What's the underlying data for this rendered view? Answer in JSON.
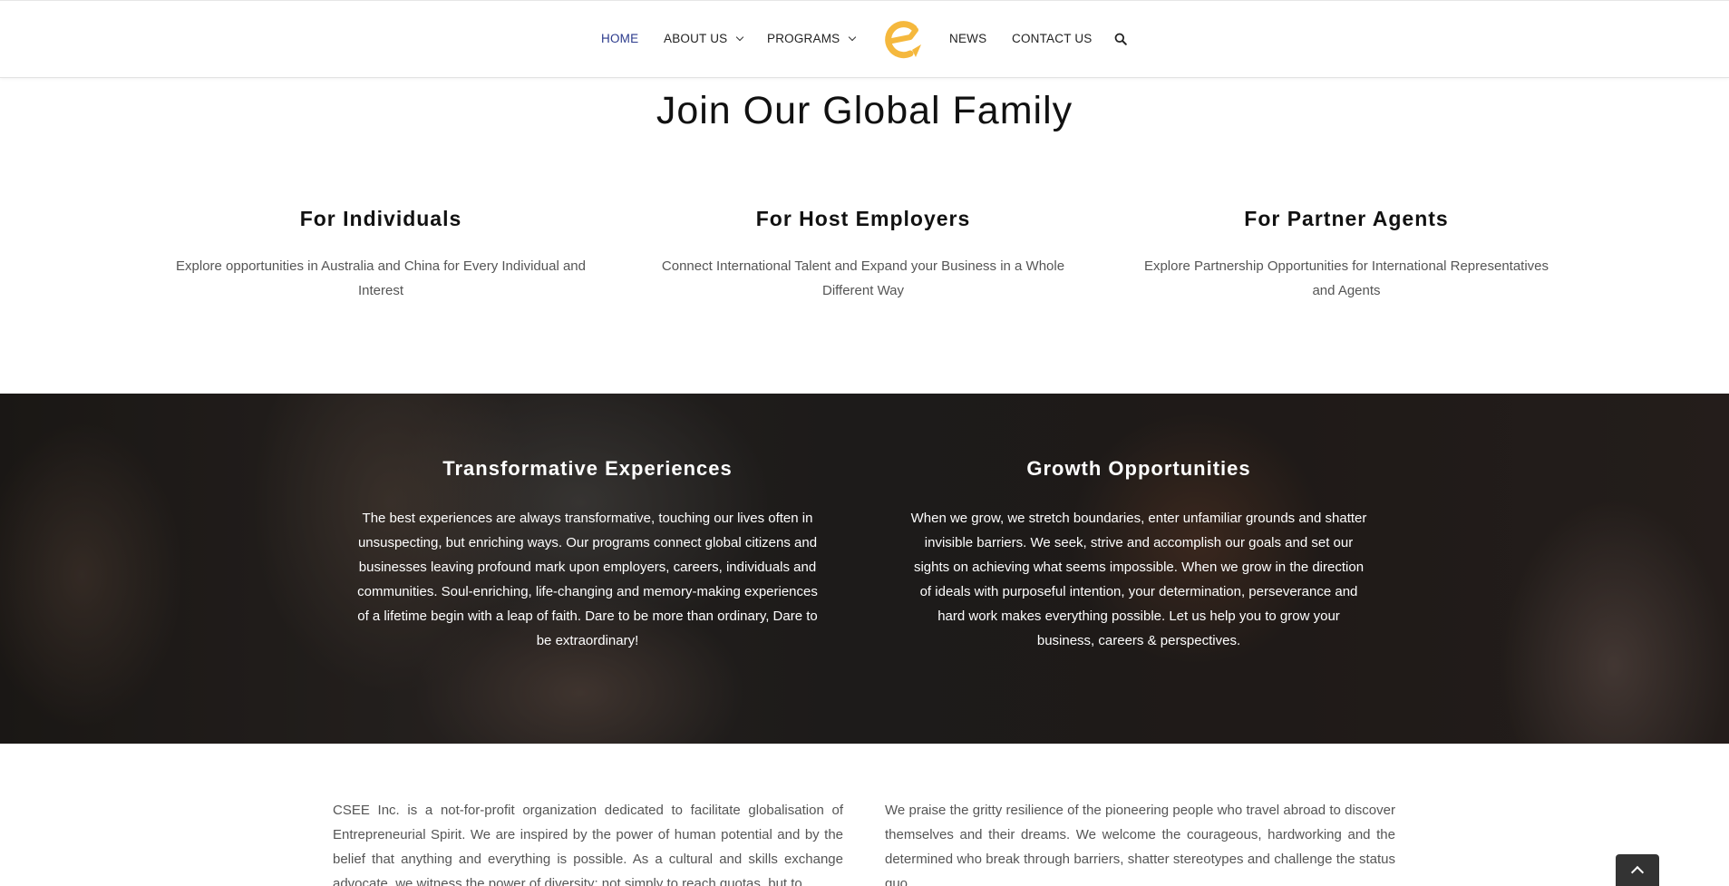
{
  "nav": {
    "items": [
      {
        "label": "HOME",
        "has_dropdown": false,
        "active": true
      },
      {
        "label": "ABOUT US",
        "has_dropdown": true,
        "active": false
      },
      {
        "label": "PROGRAMS",
        "has_dropdown": true,
        "active": false
      },
      {
        "label": "NEWS",
        "has_dropdown": false,
        "active": false
      },
      {
        "label": "CONTACT US",
        "has_dropdown": false,
        "active": false
      }
    ],
    "logo_icon": "csee-logo-icon",
    "search_icon": "search-icon",
    "active_color": "#2b3a8c",
    "logo_color": "#f5b83d"
  },
  "join": {
    "title": "Join Our Global Family",
    "columns": [
      {
        "heading": "For Individuals",
        "text": "Explore opportunities in Australia and China for Every Individual and Interest"
      },
      {
        "heading": "For Host Employers",
        "text": "Connect International Talent and Expand your Business in a Whole Different Way"
      },
      {
        "heading": "For Partner Agents",
        "text": "Explore Partnership Opportunities for International Representatives and Agents"
      }
    ]
  },
  "band": {
    "columns": [
      {
        "heading": "Transformative Experiences",
        "text": "The best experiences are always transformative, touching our lives often in unsuspecting, but enriching ways. Our programs connect global citizens and businesses leaving profound mark upon employers, careers, individuals and communities. Soul-enriching, life-changing and memory-making experiences of a lifetime begin with a leap of faith. Dare to be more than ordinary, Dare to be extraordinary!"
      },
      {
        "heading": "Growth Opportunities",
        "text": "When we grow, we stretch boundaries, enter unfamiliar grounds and shatter invisible barriers. We seek, strive and accomplish our goals and set our sights on achieving what seems impossible. When we grow in the direction of ideals with purposeful intention, your determination, perseverance and hard work makes everything possible. Let us help you to grow your business, careers & perspectives."
      }
    ]
  },
  "about": {
    "left": "CSEE Inc. is a not-for-profit organization dedicated to facilitate globalisation of Entrepreneurial Spirit. We are inspired by the power of human potential and by the belief that anything and everything is possible. As a cultural and skills exchange advocate, we witness the power of diversity; not simply to reach quotas, but to",
    "right": "We praise the gritty resilience of the pioneering people who travel abroad to discover themselves and their dreams. We welcome the courageous, hardworking and the determined who break through barriers, shatter stereotypes and challenge the status quo."
  },
  "back_to_top_icon": "chevron-up-icon"
}
